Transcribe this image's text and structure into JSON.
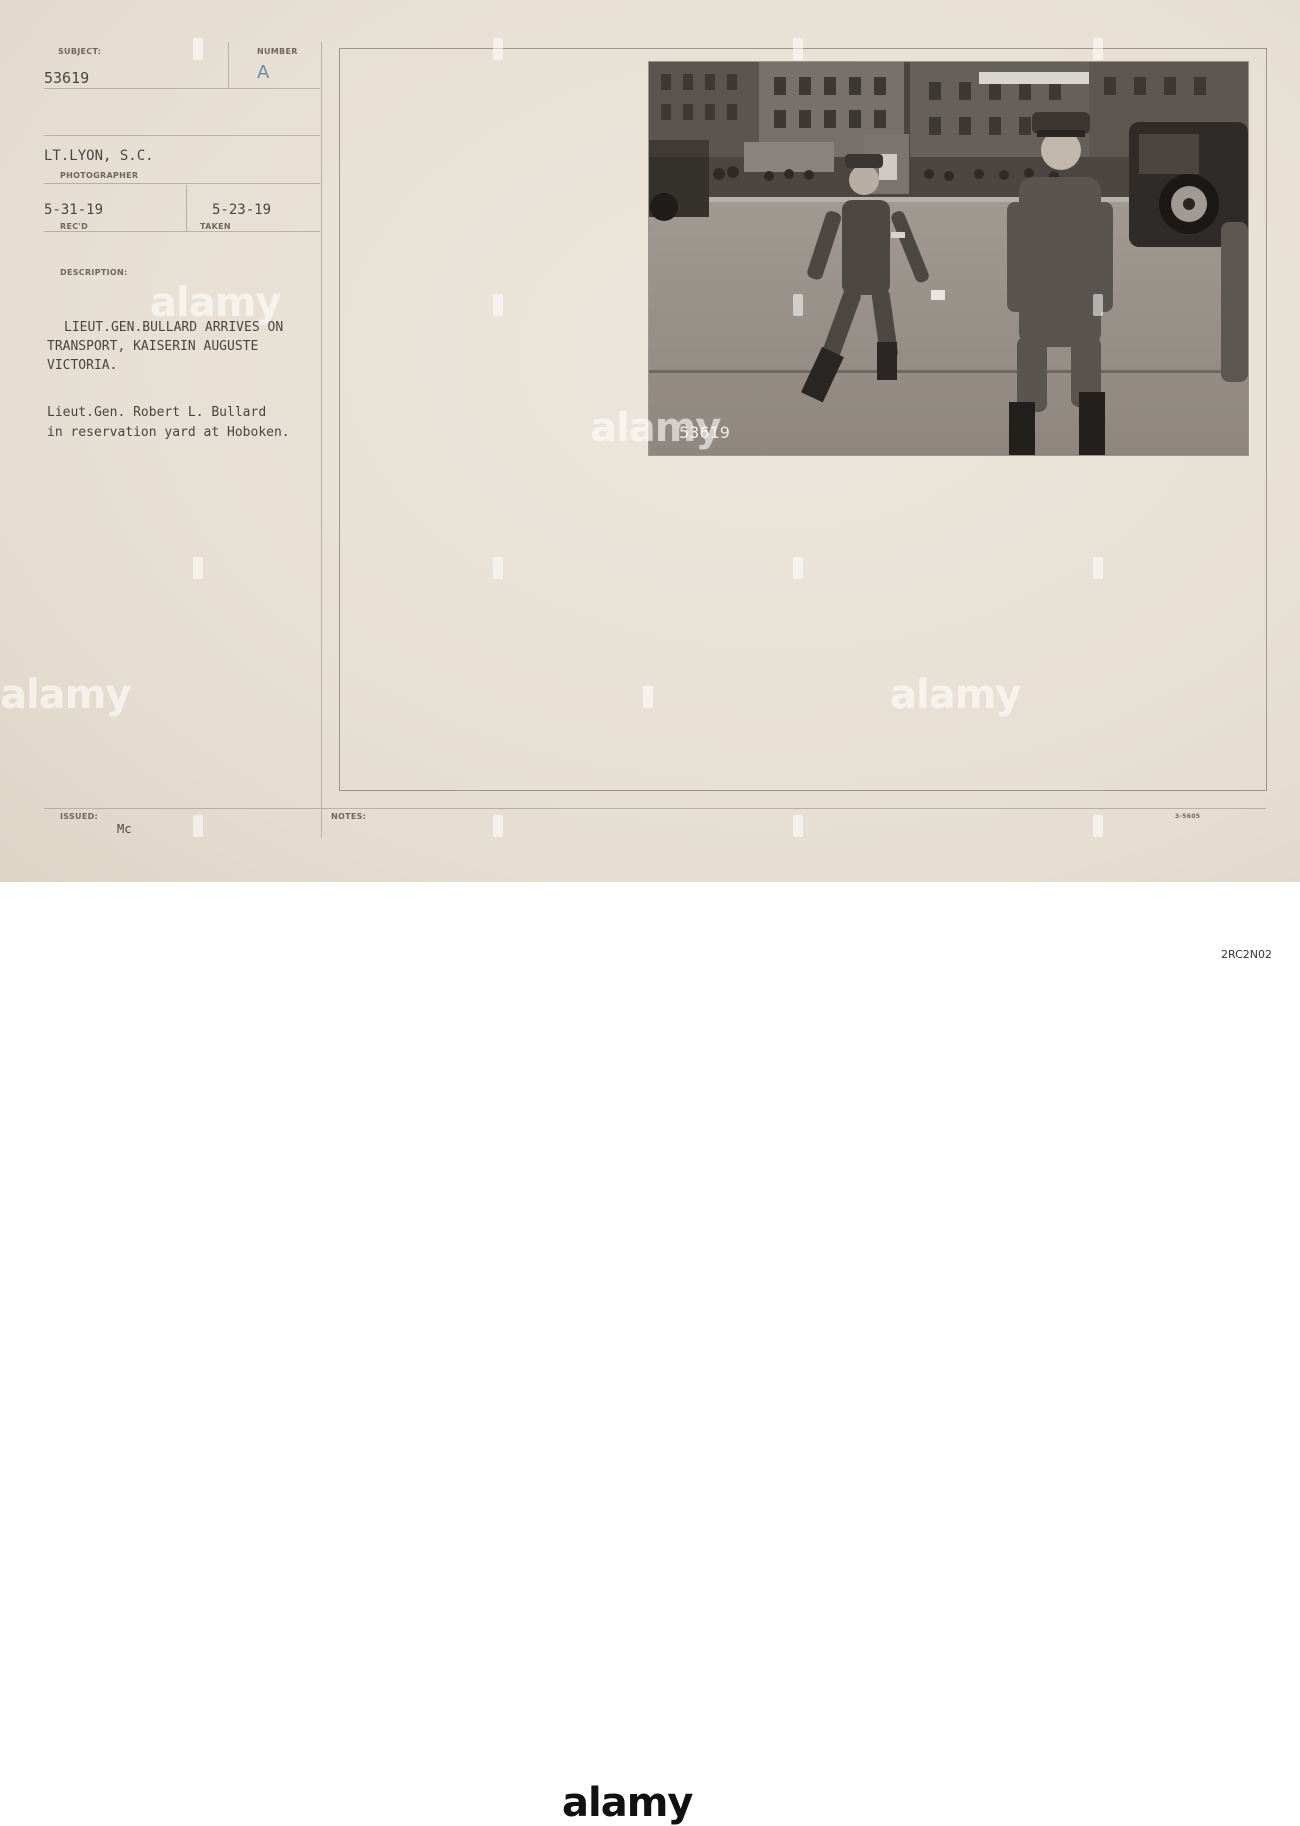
{
  "card": {
    "subject_label": "SUBJECT:",
    "subject_value": "53619",
    "number_label": "NUMBER",
    "number_value": "A",
    "photographer_value": "LT.LYON, S.C.",
    "photographer_label": "PHOTOGRAPHER",
    "received_value": "5-31-19",
    "received_label": "REC'D",
    "taken_value": "5-23-19",
    "taken_label": "TAKEN",
    "description_label": "DESCRIPTION:",
    "description_line_1": "LIEUT.GEN.BULLARD ARRIVES ON",
    "description_line_2": "TRANSPORT, KAISERIN AUGUSTE",
    "description_line_3": "VICTORIA.",
    "caption_line_1": "Lieut.Gen. Robert L. Bullard",
    "caption_line_2": "in reservation yard at Hoboken.",
    "issued_label": "ISSUED:",
    "issued_value": "Mc",
    "notes_label": "NOTES:",
    "form_number": "3-5605"
  },
  "photo": {
    "negative_number": "53619"
  },
  "watermark": {
    "logo": "alamy",
    "image_id": "2RC2N02"
  }
}
